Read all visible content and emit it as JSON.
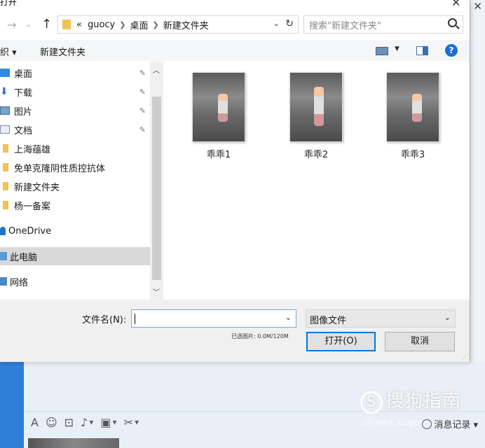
{
  "dialog": {
    "title": "打开",
    "close_glyph": "✕"
  },
  "nav": {
    "back_glyph": "→",
    "forward_glyph": "⌄",
    "up_glyph": "↑"
  },
  "address": {
    "overflow": "«",
    "crumbs": [
      "guocy",
      "桌面",
      "新建文件夹"
    ]
  },
  "search": {
    "placeholder": "搜索\"新建文件夹\""
  },
  "commandbar": {
    "organize_label": "织 ▾",
    "new_folder_label": "新建文件夹",
    "help_glyph": "?"
  },
  "sidebar": {
    "items": [
      {
        "label": "桌面",
        "icon": "desktop-icon",
        "pinned": true
      },
      {
        "label": "下载",
        "icon": "download-icon",
        "pinned": true
      },
      {
        "label": "图片",
        "icon": "pictures-icon",
        "pinned": true
      },
      {
        "label": "文档",
        "icon": "documents-icon",
        "pinned": true
      },
      {
        "label": "上海蕴雄",
        "icon": "folder-icon",
        "pinned": false
      },
      {
        "label": "免单克隆阴性质控抗体",
        "icon": "folder-icon",
        "pinned": false
      },
      {
        "label": "新建文件夹",
        "icon": "folder-icon",
        "pinned": false
      },
      {
        "label": "杨一备案",
        "icon": "folder-icon",
        "pinned": false
      },
      {
        "label": "OneDrive",
        "icon": "cloud-icon",
        "pinned": false
      },
      {
        "label": "此电脑",
        "icon": "computer-icon",
        "pinned": false,
        "selected": true
      },
      {
        "label": "网络",
        "icon": "network-icon",
        "pinned": false
      }
    ],
    "pin_glyph": "✎"
  },
  "files": [
    {
      "name": "乖乖1"
    },
    {
      "name": "乖乖2"
    },
    {
      "name": "乖乖3"
    }
  ],
  "bottom": {
    "filename_label": "文件名(N):",
    "filename_value": "",
    "filetype_value": "图像文件",
    "selection_info": "已选图片: 0.0M/120M",
    "open_label": "打开(O)",
    "cancel_label": "取消"
  },
  "chat": {
    "history_label": "消息记录 ▾",
    "watermark": "搜狗指南",
    "watermark_sub": "zhinan.sogou.com",
    "toolbar": [
      "A",
      "☺",
      "⊡",
      "♪",
      "▣",
      "✂"
    ]
  },
  "colors": {
    "accent": "#0078d7",
    "selected_row": "#d9d9d9",
    "folder": "#f3c24f",
    "chat_strip": "#2f7fd6"
  }
}
